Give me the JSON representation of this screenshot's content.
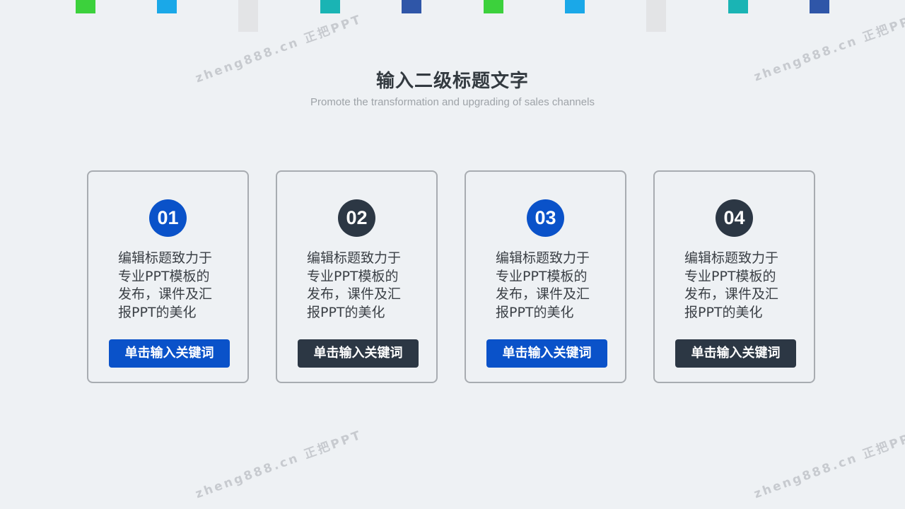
{
  "slide": {
    "title": "输入二级标题文字",
    "subtitle": "Promote the transformation  and upgrading of sales channels"
  },
  "decor": {
    "top_colors": [
      "#3cd13c",
      "#1aa8e8",
      "#1ab4b4",
      "#2f56a8",
      "#3cd13c",
      "#1aa8e8",
      "#1ab4b4",
      "#2f56a8"
    ],
    "bar_color": "#e3e4e6"
  },
  "cards": [
    {
      "number": "01",
      "lines": [
        "编辑标题致力于",
        "专业PPT模板的",
        "发布，课件及汇",
        "报PPT的美化"
      ],
      "button": "单击输入关键词",
      "accent": "#0a52c9"
    },
    {
      "number": "02",
      "lines": [
        "编辑标题致力于",
        "专业PPT模板的",
        "发布，课件及汇",
        "报PPT的美化"
      ],
      "button": "单击输入关键词",
      "accent": "#2c3744"
    },
    {
      "number": "03",
      "lines": [
        "编辑标题致力于",
        "专业PPT模板的",
        "发布，课件及汇",
        "报PPT的美化"
      ],
      "button": "单击输入关键词",
      "accent": "#0a52c9"
    },
    {
      "number": "04",
      "lines": [
        "编辑标题致力于",
        "专业PPT模板的",
        "发布，课件及汇",
        "报PPT的美化"
      ],
      "button": "单击输入关键词",
      "accent": "#2c3744"
    }
  ],
  "watermark": "zheng888.cn 正把PPT"
}
